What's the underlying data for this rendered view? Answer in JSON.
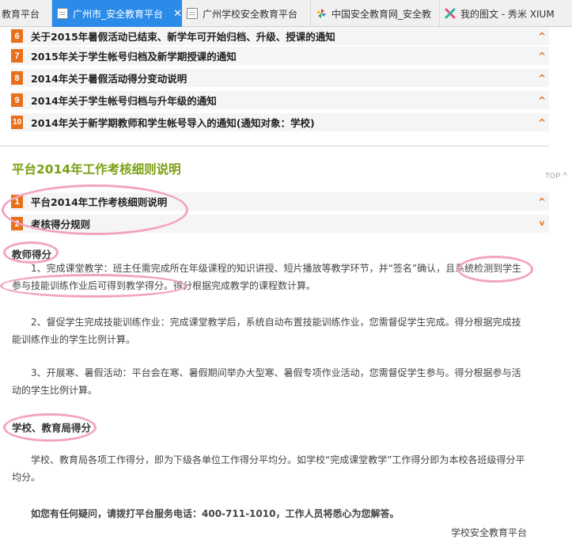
{
  "tabs": [
    {
      "label": "教育平台",
      "active": false,
      "icon": "none"
    },
    {
      "label": "广州市_安全教育平台",
      "active": true,
      "icon": "page-icon"
    },
    {
      "label": "广州学校安全教育平台",
      "active": false,
      "icon": "page-icon"
    },
    {
      "label": "中国安全教育网_安全教",
      "active": false,
      "icon": "pinwheel-icon"
    },
    {
      "label": "我的图文 - 秀米 XIUM",
      "active": false,
      "icon": "xiumi-icon"
    }
  ],
  "close_glyph": "✕",
  "notices": [
    {
      "num": "6",
      "title": "关于2015年暑假活动已结束、新学年可开始归档、升级、授课的通知"
    },
    {
      "num": "7",
      "title": "2015年关于学生帐号归档及新学期授课的通知"
    },
    {
      "num": "8",
      "title": "2014年关于暑假活动得分变动说明"
    },
    {
      "num": "9",
      "title": "2014年关于学生帐号归档与升年级的通知"
    },
    {
      "num": "10",
      "title": "2014年关于新学期教师和学生帐号导入的通知(通知对象：学校)"
    }
  ],
  "caret_up": "^",
  "caret_down": "v",
  "section": {
    "title": "平台2014年工作考核细则说明",
    "top_link": "TOP",
    "items": [
      {
        "num": "1",
        "title": "平台2014年工作考核细则说明",
        "caret": "up"
      },
      {
        "num": "2",
        "title": "考核得分规则",
        "caret": "down"
      }
    ]
  },
  "teacher": {
    "heading": "教师得分",
    "p1": "1、完成课堂教学：班主任需完成所在年级课程的知识讲授、短片播放等教学环节，并“签名”确认，且系统检测到学生参与技能训练作业后可得到教学得分。得分根据完成教学的课程数计算。",
    "p2": "2、督促学生完成技能训练作业：完成课堂教学后，系统自动布置技能训练作业，您需督促学生完成。得分根据完成技能训练作业的学生比例计算。",
    "p3": "3、开展寒、暑假活动：平台会在寒、暑假期间举办大型寒、暑假专项作业活动，您需督促学生参与。得分根据参与活动的学生比例计算。"
  },
  "school": {
    "heading": "学校、教育局得分",
    "p1": "学校、教育局各项工作得分，即为下级各单位工作得分平均分。如学校“完成课堂教学”工作得分即为本校各班级得分平均分。"
  },
  "contact": "如您有任何疑问，请拨打平台服务电话：400-711-1010，工作人员将悉心为您解答。",
  "signature": "学校安全教育平台",
  "colors": {
    "accent_orange": "#e8701a",
    "section_green": "#7a9f12",
    "tab_active": "#2a8be8",
    "annotation_pink": "#f2a3c4"
  }
}
